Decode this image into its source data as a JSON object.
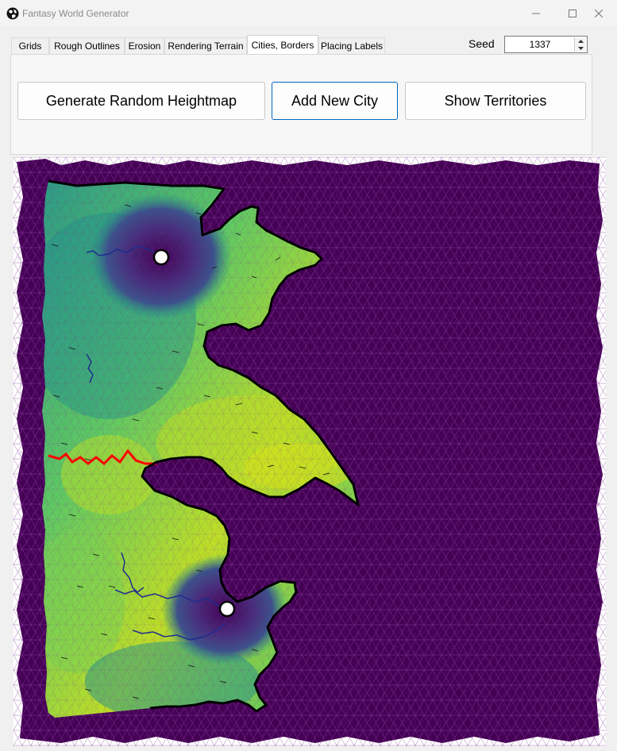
{
  "window": {
    "title": "Fantasy World Generator"
  },
  "tabs": [
    {
      "label": "Grids",
      "active": false
    },
    {
      "label": "Rough Outlines",
      "active": false
    },
    {
      "label": "Erosion",
      "active": false
    },
    {
      "label": "Rendering Terrain",
      "active": false
    },
    {
      "label": "Cities, Borders",
      "active": true
    },
    {
      "label": "Placing Labels",
      "active": false
    }
  ],
  "seed": {
    "label": "Seed",
    "value": "1337"
  },
  "buttons": {
    "heightmap": "Generate Random Heightmap",
    "add_city": "Add New City",
    "territories": "Show Territories"
  },
  "map": {
    "ocean_color": "#440154",
    "mesh_color": "#7a2d8f",
    "land_colors": [
      "#3b528b",
      "#21918c",
      "#5ec962",
      "#bddf26",
      "#fde725"
    ],
    "coast_color": "#000000",
    "river_color": "#1f2c8f",
    "border_color": "#ff0000",
    "cities": 2
  }
}
